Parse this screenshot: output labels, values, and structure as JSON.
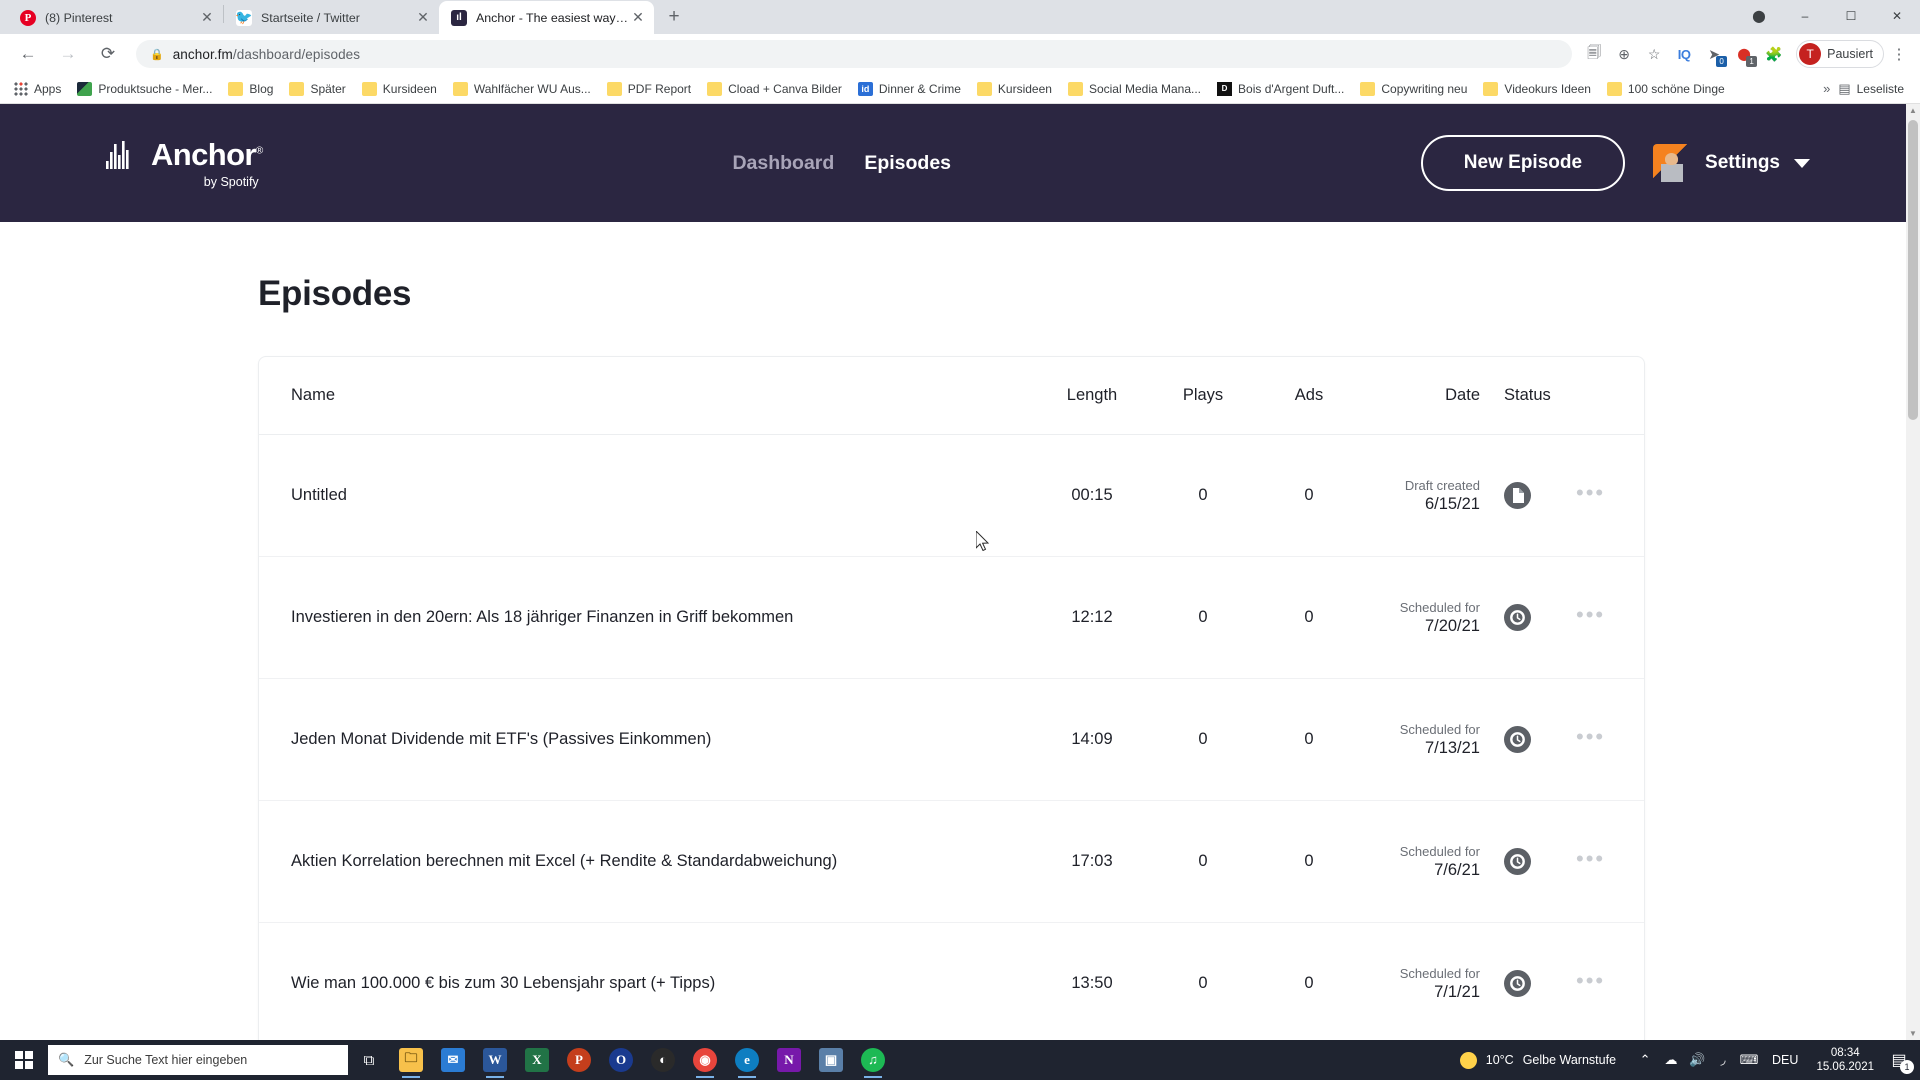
{
  "browser": {
    "tabs": [
      {
        "title": "(8) Pinterest",
        "icon": "pinterest-favicon",
        "active": false
      },
      {
        "title": "Startseite / Twitter",
        "icon": "twitter-favicon",
        "active": false
      },
      {
        "title": "Anchor - The easiest way to mak",
        "icon": "anchor-favicon",
        "active": true
      }
    ],
    "new_tab_label": "+",
    "window_controls": {
      "minimize": "–",
      "maximize": "☐",
      "close": "✕"
    },
    "nav": {
      "back": "←",
      "forward": "→",
      "reload": "⟳"
    },
    "url": "anchor.fm/dashboard/episodes",
    "url_domain": "anchor.fm",
    "url_path": "/dashboard/episodes",
    "lock_icon": "lock-icon",
    "toolbar_icons": [
      {
        "name": "translate-icon",
        "glyph": "⎋"
      },
      {
        "name": "zoom-icon",
        "glyph": "⊕"
      },
      {
        "name": "bookmark-star-icon",
        "glyph": "☆"
      },
      {
        "name": "extension-iq-icon",
        "glyph": "IQ"
      },
      {
        "name": "extension-pocket-icon",
        "glyph": "➤",
        "badge": "0",
        "badge_color": "#1b5fa8"
      },
      {
        "name": "extension-adblock-icon",
        "glyph": "ABP",
        "badge": "1",
        "badge_color": "#5f6368"
      },
      {
        "name": "extensions-puzzle-icon",
        "glyph": "✦"
      }
    ],
    "profile": {
      "initial": "T",
      "label": "Pausiert"
    },
    "menu_icon": "⋮",
    "bookmarks": [
      {
        "label": "Apps",
        "icon": "apps-grid-icon"
      },
      {
        "label": "Produktsuche - Mer...",
        "icon": "site-favicon-green"
      },
      {
        "label": "Blog",
        "icon": "folder-icon"
      },
      {
        "label": "Später",
        "icon": "folder-icon"
      },
      {
        "label": "Kursideen",
        "icon": "folder-icon"
      },
      {
        "label": "Wahlfächer WU Aus...",
        "icon": "folder-icon"
      },
      {
        "label": "PDF Report",
        "icon": "folder-icon"
      },
      {
        "label": "Cload + Canva Bilder",
        "icon": "folder-icon"
      },
      {
        "label": "Dinner & Crime",
        "icon": "site-favicon-blue",
        "initial": "id"
      },
      {
        "label": "Kursideen",
        "icon": "folder-icon"
      },
      {
        "label": "Social Media Mana...",
        "icon": "folder-icon"
      },
      {
        "label": "Bois d'Argent Duft...",
        "icon": "site-favicon-dark",
        "initial": "D"
      },
      {
        "label": "Copywriting neu",
        "icon": "folder-icon"
      },
      {
        "label": "Videokurs Ideen",
        "icon": "folder-icon"
      },
      {
        "label": "100 schöne Dinge",
        "icon": "folder-icon"
      }
    ],
    "bookmarks_overflow": "»",
    "reading_list": {
      "label": "Leseliste",
      "icon": "reading-list-icon"
    }
  },
  "app": {
    "logo": {
      "text": "Anchor",
      "registered": "®",
      "subtitle": "by Spotify",
      "icon": "anchor-waveform-icon"
    },
    "nav": [
      {
        "label": "Dashboard",
        "active": false
      },
      {
        "label": "Episodes",
        "active": true
      }
    ],
    "new_episode_button": "New Episode",
    "settings": {
      "label": "Settings",
      "avatar": "user-avatar",
      "chevron": "chevron-down-icon"
    },
    "page_title": "Episodes",
    "table": {
      "headers": {
        "name": "Name",
        "length": "Length",
        "plays": "Plays",
        "ads": "Ads",
        "date": "Date",
        "status": "Status"
      },
      "rows": [
        {
          "name": "Untitled",
          "length": "00:15",
          "plays": "0",
          "ads": "0",
          "date_label": "Draft created",
          "date_value": "6/15/21",
          "status_icon": "draft-document-icon"
        },
        {
          "name": "Investieren in den 20ern: Als 18 jähriger Finanzen in Griff bekommen",
          "length": "12:12",
          "plays": "0",
          "ads": "0",
          "date_label": "Scheduled for",
          "date_value": "7/20/21",
          "status_icon": "scheduled-clock-icon"
        },
        {
          "name": "Jeden Monat Dividende mit ETF's (Passives Einkommen)",
          "length": "14:09",
          "plays": "0",
          "ads": "0",
          "date_label": "Scheduled for",
          "date_value": "7/13/21",
          "status_icon": "scheduled-clock-icon"
        },
        {
          "name": "Aktien Korrelation berechnen mit Excel (+ Rendite & Standardabweichung)",
          "length": "17:03",
          "plays": "0",
          "ads": "0",
          "date_label": "Scheduled for",
          "date_value": "7/6/21",
          "status_icon": "scheduled-clock-icon"
        },
        {
          "name": "Wie man 100.000 € bis zum 30 Lebensjahr spart (+ Tipps)",
          "length": "13:50",
          "plays": "0",
          "ads": "0",
          "date_label": "Scheduled for",
          "date_value": "7/1/21",
          "status_icon": "scheduled-clock-icon"
        }
      ],
      "row_menu_glyph": "•••"
    },
    "colors": {
      "header_bg": "#2b2641",
      "text_primary": "#1f2129",
      "text_muted": "#6b6f76",
      "status_icon_bg": "#5c6066"
    }
  },
  "taskbar": {
    "start_icon": "windows-start-icon",
    "search_placeholder": "Zur Suche Text hier eingeben",
    "search_icon": "search-icon",
    "apps": [
      {
        "name": "task-view-icon",
        "glyph": "⧉",
        "color": "transparent",
        "open": false
      },
      {
        "name": "file-explorer-icon",
        "glyph": "🗀",
        "color": "#f7c14b",
        "open": true
      },
      {
        "name": "mail-icon",
        "glyph": "✉",
        "color": "#2b7cd3",
        "open": false
      },
      {
        "name": "word-icon",
        "glyph": "W",
        "color": "#2b579a",
        "open": true
      },
      {
        "name": "excel-icon",
        "glyph": "X",
        "color": "#217346",
        "open": false
      },
      {
        "name": "powerpoint-icon",
        "glyph": "P",
        "color": "#c43e1c",
        "open": false
      },
      {
        "name": "opera-icon",
        "glyph": "O",
        "color": "#1a3a8f",
        "open": false
      },
      {
        "name": "dark-app-icon",
        "glyph": "●",
        "color": "#2a2a2a",
        "open": false
      },
      {
        "name": "chrome-icon",
        "glyph": "◉",
        "color": "#e8453c",
        "open": true
      },
      {
        "name": "edge-icon",
        "glyph": "e",
        "color": "#0e7ec1",
        "open": true
      },
      {
        "name": "onenote-icon",
        "glyph": "N",
        "color": "#7719aa",
        "open": false
      },
      {
        "name": "photos-icon",
        "glyph": "▣",
        "color": "#5a7fa8",
        "open": false
      },
      {
        "name": "spotify-icon",
        "glyph": "♫",
        "color": "#1db954",
        "open": true
      }
    ],
    "weather": {
      "temp": "10°C",
      "text": "Gelbe Warnstufe",
      "icon": "sun-icon"
    },
    "tray": [
      {
        "name": "show-hidden-icons",
        "glyph": "∧"
      },
      {
        "name": "onedrive-icon",
        "glyph": "☁"
      },
      {
        "name": "volume-icon",
        "glyph": "🔊"
      },
      {
        "name": "wifi-icon",
        "glyph": "◠"
      },
      {
        "name": "keyboard-icon",
        "glyph": "⌨"
      }
    ],
    "language": "DEU",
    "time": "08:34",
    "date": "15.06.2021",
    "notifications": {
      "icon": "notification-icon",
      "count": "1"
    }
  }
}
